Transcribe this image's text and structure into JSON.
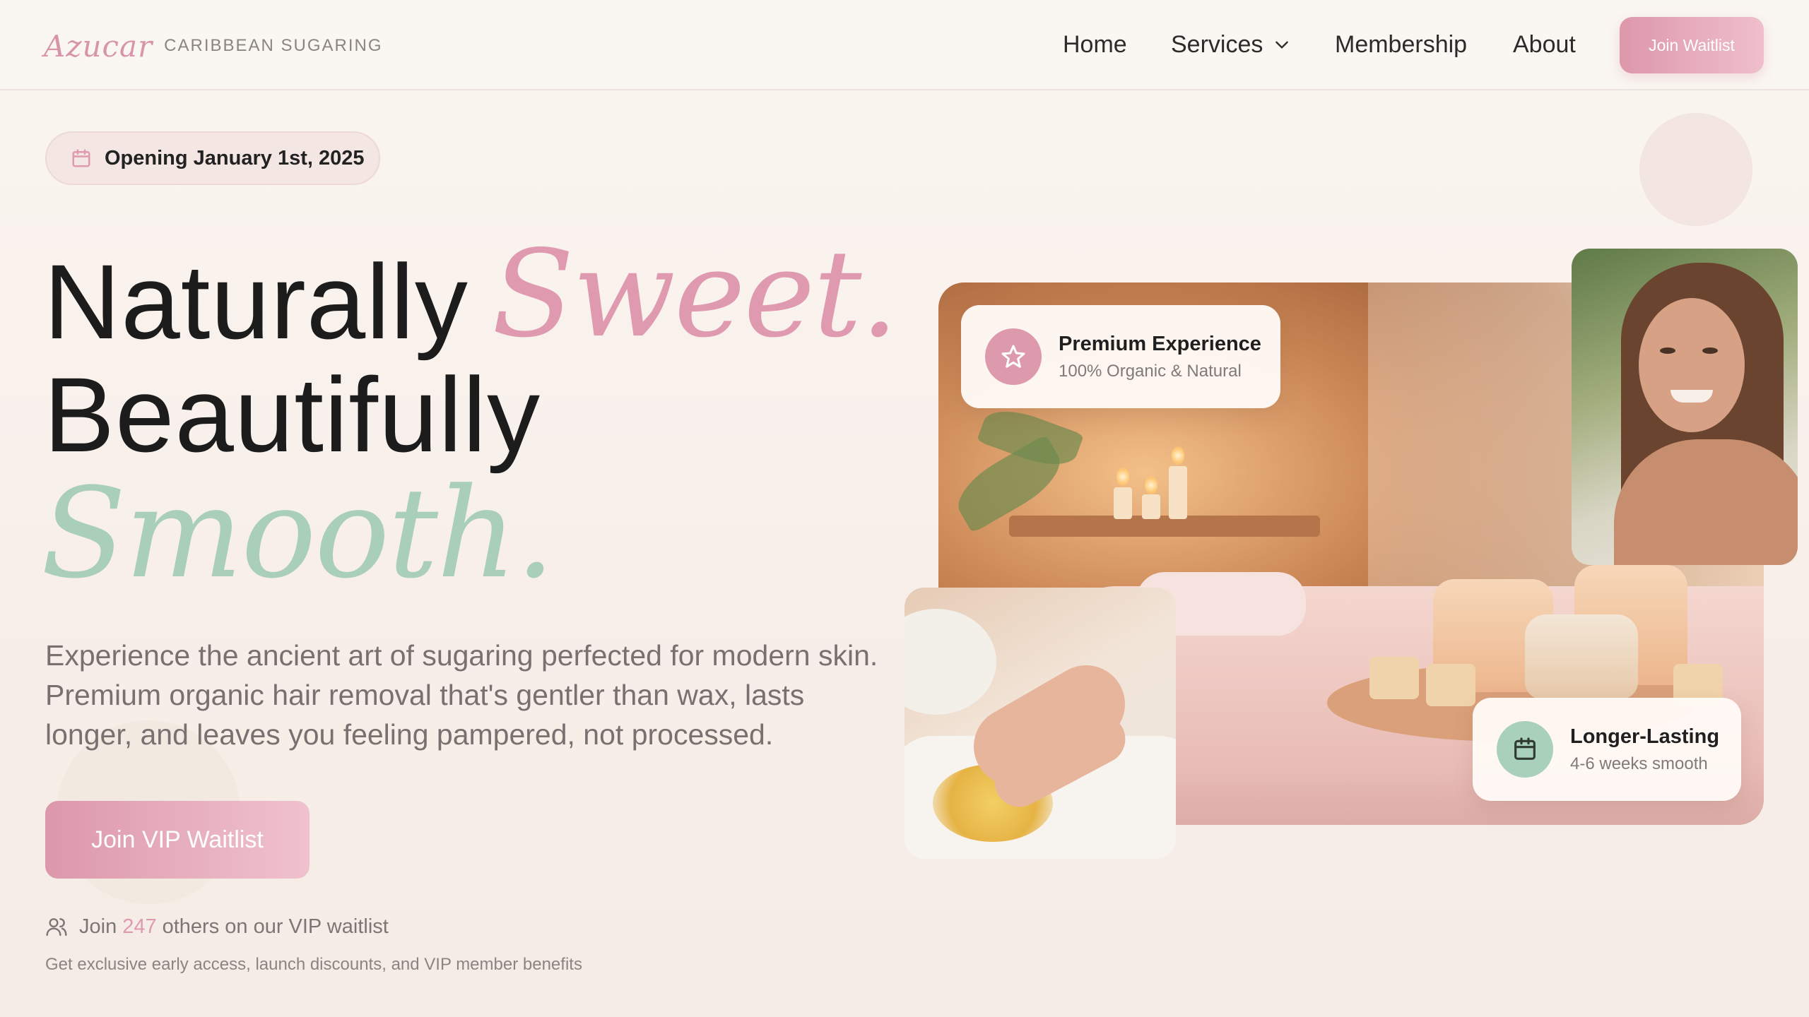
{
  "brand": {
    "logo": "Azucar",
    "tagline": "CARIBBEAN SUGARING"
  },
  "nav": {
    "home": "Home",
    "services": "Services",
    "membership": "Membership",
    "about": "About",
    "cta": "Join Waitlist"
  },
  "hero": {
    "badge": "Opening January 1st, 2025",
    "headline_1": "Naturally",
    "headline_1_script": "Sweet.",
    "headline_2": "Beautifully",
    "headline_3_script": "Smooth.",
    "lead": "Experience the ancient art of sugaring perfected for modern skin. Premium organic hair removal that's gentler than wax, lasts longer, and leaves you feeling pampered, not processed.",
    "cta": "Join VIP Waitlist",
    "waitlist_prefix": "Join",
    "waitlist_count": "247",
    "waitlist_suffix": "others on our VIP waitlist",
    "fine_print": "Get exclusive early access, launch discounts, and VIP member benefits"
  },
  "cards": {
    "premium": {
      "title": "Premium Experience",
      "subtitle": "100% Organic & Natural",
      "icon": "star-icon"
    },
    "lasting": {
      "title": "Longer-Lasting",
      "subtitle": "4-6 weeks smooth",
      "icon": "calendar-icon"
    }
  },
  "colors": {
    "accent_pink": "#df9ab0",
    "accent_mint": "#a9cfb8",
    "background": "#faf5f0"
  }
}
